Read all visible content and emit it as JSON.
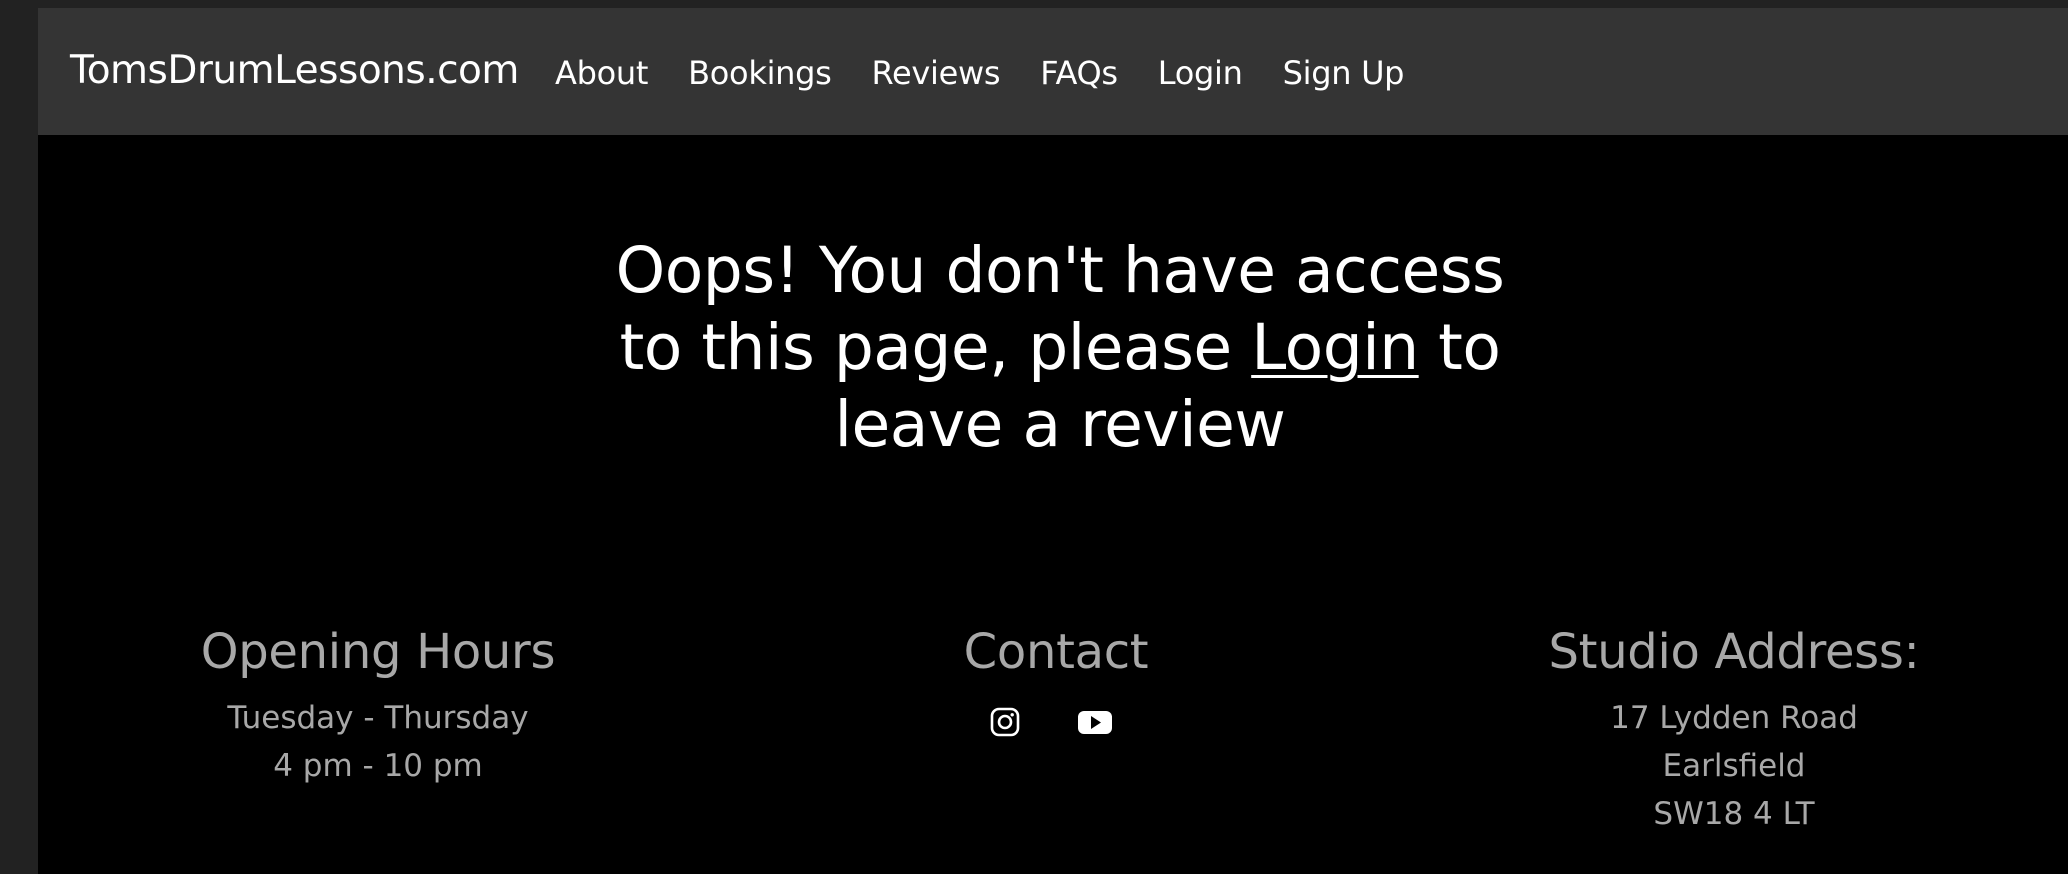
{
  "navbar": {
    "brand": "TomsDrumLessons.com",
    "links": [
      "About",
      "Bookings",
      "Reviews",
      "FAQs",
      "Login",
      "Sign Up"
    ]
  },
  "hero": {
    "line1": "Oops! You don't have access",
    "line2_before": "to this page, please ",
    "login_link": "Login",
    "line2_after": " to",
    "line3": "leave a review"
  },
  "footer": {
    "hours": {
      "title": "Opening Hours",
      "lines": [
        "Tuesday - Thursday",
        "4 pm - 10 pm"
      ]
    },
    "contact": {
      "title": "Contact",
      "icons": [
        "instagram-icon",
        "youtube-icon"
      ]
    },
    "address": {
      "title": "Studio Address:",
      "lines": [
        "17 Lydden Road",
        "Earlsfield",
        "SW18 4 LT"
      ]
    }
  },
  "colors": {
    "navbar_bg": "#343434",
    "page_bg": "#000000",
    "footer_text": "#a8a8a8",
    "text": "#ffffff"
  }
}
